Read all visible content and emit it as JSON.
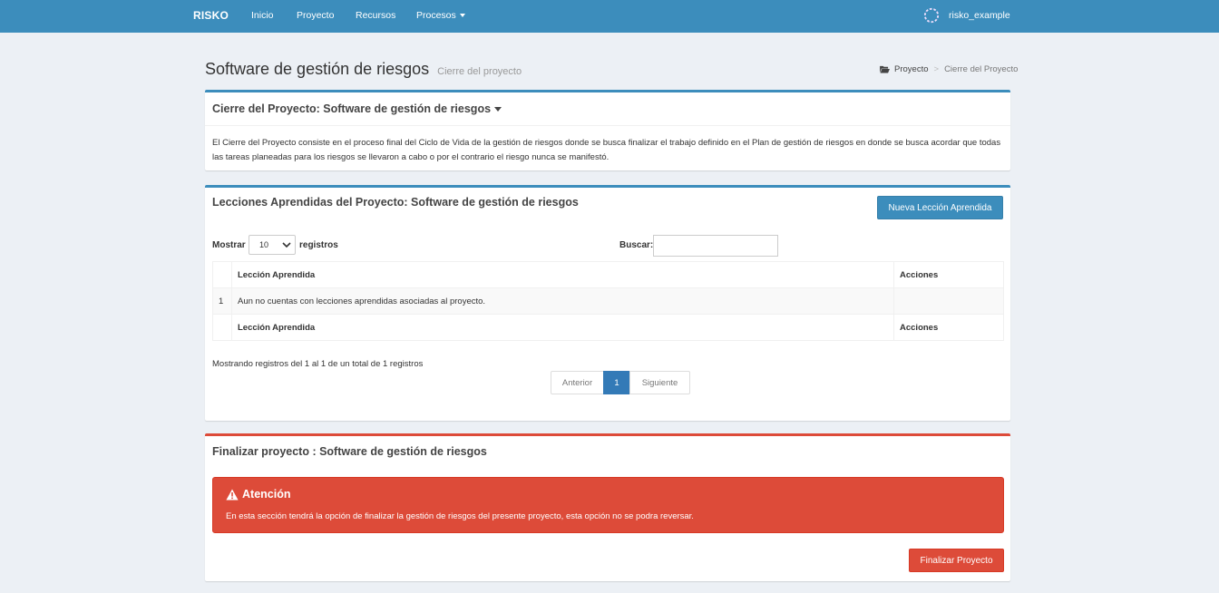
{
  "navbar": {
    "brand": "RISKO",
    "items": [
      {
        "label": "Inicio"
      },
      {
        "label": "Proyecto"
      },
      {
        "label": "Recursos"
      },
      {
        "label": "Procesos"
      }
    ],
    "user": "risko_example"
  },
  "header": {
    "title": "Software de gestión de riesgos",
    "subtitle": "Cierre del proyecto",
    "breadcrumb": [
      "Proyecto",
      "Cierre del Proyecto"
    ],
    "breadcrumb_separator": ">"
  },
  "closure_box": {
    "title": "Cierre del Proyecto: Software de gestión de riesgos",
    "description": "El Cierre del Proyecto consiste en el proceso final del Ciclo de Vida de la gestión de riesgos donde se busca finalizar el trabajo definido en el Plan de gestión de riesgos en donde se busca acordar que todas las tareas planeadas para los riesgos se llevaron a cabo o por el contrario el riesgo nunca se manifestó."
  },
  "lessons_box": {
    "title": "Lecciones Aprendidas del Proyecto: Software de gestión de riesgos",
    "new_button": "Nueva Lección Aprendida",
    "show_label": "Mostrar",
    "page_size": "10",
    "records_label": "registros",
    "search_label": "Buscar:",
    "search_value": "",
    "columns": [
      "",
      "Lección Aprendida",
      "Acciones"
    ],
    "rows": [
      {
        "num": "1",
        "lesson": "Aun no cuentas con lecciones aprendidas asociadas al proyecto.",
        "actions": ""
      }
    ],
    "info": "Mostrando registros del 1 al 1 de un total de 1 registros",
    "pagination": {
      "prev": "Anterior",
      "current": "1",
      "next": "Siguiente"
    }
  },
  "finalize_box": {
    "title": "Finalizar proyecto : Software de gestión de riesgos",
    "alert_title": "Atención",
    "alert_message": "En esta sección tendrá la opción de finalizar la gestión de riesgos del presente proyecto, esta opción no se podra reversar.",
    "finalize_button": "Finalizar Proyecto"
  },
  "colors": {
    "primary": "#3c8dbc",
    "danger": "#dd4b39",
    "background": "#ecf0f5"
  },
  "icons": [
    "avatar-icon",
    "folder-open-icon",
    "warning-icon",
    "chevron-down-icon",
    "caret-down-icon"
  ]
}
